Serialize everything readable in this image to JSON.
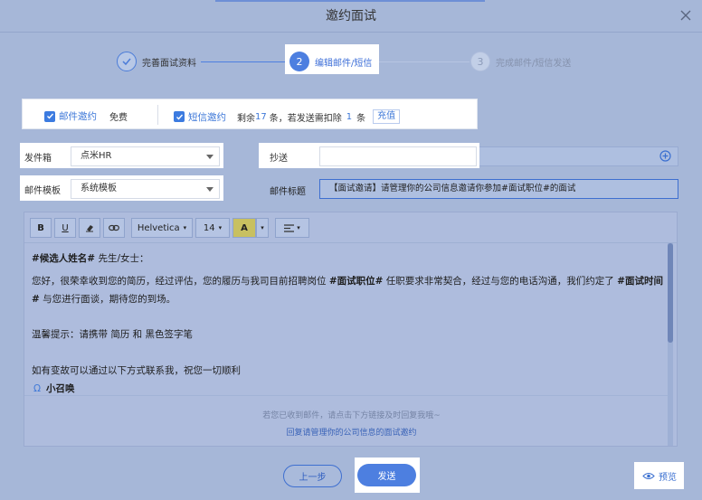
{
  "dialog": {
    "title": "邀约面试"
  },
  "steps": [
    {
      "num": "",
      "label": "完善面试资料"
    },
    {
      "num": "2",
      "label": "编辑邮件/短信"
    },
    {
      "num": "3",
      "label": "完成邮件/短信发送"
    }
  ],
  "channels": {
    "email_label": "邮件邀约",
    "email_note": "免费",
    "sms_label": "短信邀约",
    "sms_prefix": "剩余",
    "sms_count": "17",
    "sms_mid": "条，若发送需扣除",
    "sms_cost": "1",
    "sms_suffix": "条",
    "recharge": "充值"
  },
  "form": {
    "mailbox_label": "发件箱",
    "mailbox_value": "点米HR",
    "cc_label": "抄送",
    "cc_value": "",
    "template_label": "邮件模板",
    "template_value": "系统模板",
    "subject_label": "邮件标题",
    "subject_value": "【面试邀请】请管理你的公司信息邀请你参加#面试职位#的面试"
  },
  "toolbar": {
    "bold": "B",
    "underline": "U",
    "font": "Helvetica",
    "size": "14",
    "color": "A"
  },
  "body": {
    "greeting_var": "#候选人姓名#",
    "greeting_rest": " 先生/女士：",
    "p1_a": "您好，很荣幸收到您的简历，经过评估，您的履历与我司目前招聘岗位 ",
    "p1_var": "#面试职位#",
    "p1_b": " 任职要求非常契合，经过与您的电话沟通，我们约定了 ",
    "p1_var2": "#面试时间#",
    "p1_c": " 与您进行面谈，期待您的到场。",
    "tip": "温馨提示：请携带 简历 和 黑色签字笔",
    "contact": "如有变故可以通过以下方式联系我，祝您一切顺利",
    "sender": "小召唤",
    "footer_note": "若您已收到邮件，请点击下方链接及时回复我哦~",
    "footer_link": "回复请管理你的公司信息的面试邀约"
  },
  "actions": {
    "prev": "上一步",
    "send": "发送",
    "preview": "预览"
  }
}
